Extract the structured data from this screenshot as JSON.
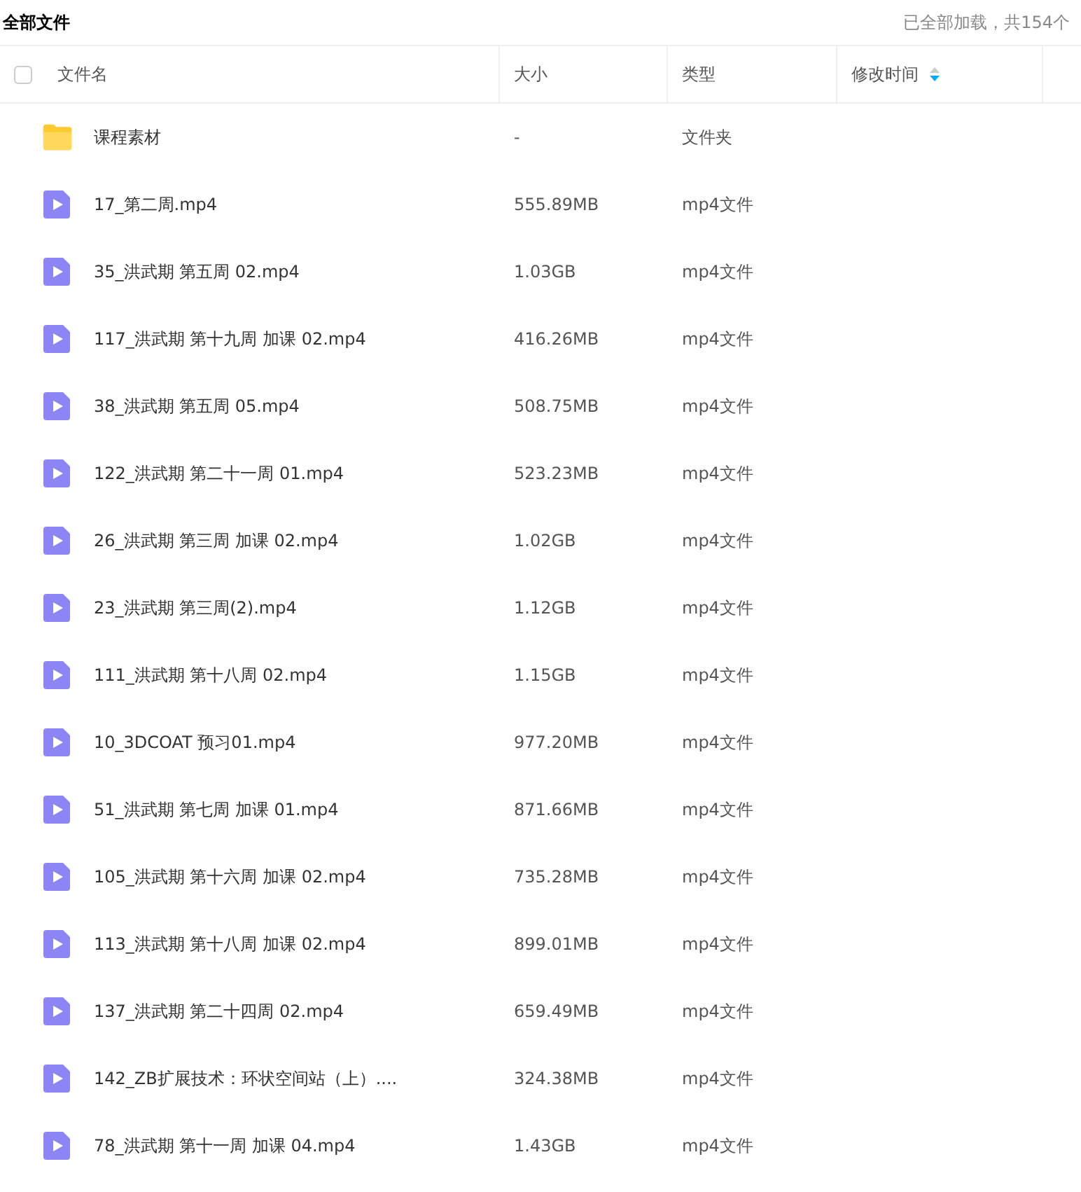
{
  "title": "全部文件",
  "load_status": "已全部加载，共154个",
  "table": {
    "select_all": {
      "checked": false
    },
    "columns": [
      {
        "label": "文件名",
        "sortable": false
      },
      {
        "label": "大小",
        "sortable": false
      },
      {
        "label": "类型",
        "sortable": false
      },
      {
        "label": "修改时间",
        "sortable": true
      }
    ],
    "rows": [
      {
        "kind": "folder",
        "name": "课程素材",
        "size": "-",
        "type": "文件夹"
      },
      {
        "kind": "video",
        "name": "17_第二周.mp4",
        "size": "555.89MB",
        "type": "mp4文件"
      },
      {
        "kind": "video",
        "name": "35_洪武期 第五周 02.mp4",
        "size": "1.03GB",
        "type": "mp4文件"
      },
      {
        "kind": "video",
        "name": "117_洪武期 第十九周 加课 02.mp4",
        "size": "416.26MB",
        "type": "mp4文件"
      },
      {
        "kind": "video",
        "name": "38_洪武期 第五周 05.mp4",
        "size": "508.75MB",
        "type": "mp4文件"
      },
      {
        "kind": "video",
        "name": "122_洪武期 第二十一周 01.mp4",
        "size": "523.23MB",
        "type": "mp4文件"
      },
      {
        "kind": "video",
        "name": "26_洪武期 第三周 加课 02.mp4",
        "size": "1.02GB",
        "type": "mp4文件"
      },
      {
        "kind": "video",
        "name": "23_洪武期 第三周(2).mp4",
        "size": "1.12GB",
        "type": "mp4文件"
      },
      {
        "kind": "video",
        "name": "111_洪武期 第十八周 02.mp4",
        "size": "1.15GB",
        "type": "mp4文件"
      },
      {
        "kind": "video",
        "name": "10_3DCOAT 预习01.mp4",
        "size": "977.20MB",
        "type": "mp4文件"
      },
      {
        "kind": "video",
        "name": "51_洪武期 第七周 加课 01.mp4",
        "size": "871.66MB",
        "type": "mp4文件"
      },
      {
        "kind": "video",
        "name": "105_洪武期 第十六周 加课 02.mp4",
        "size": "735.28MB",
        "type": "mp4文件"
      },
      {
        "kind": "video",
        "name": "113_洪武期 第十八周 加课 02.mp4",
        "size": "899.01MB",
        "type": "mp4文件"
      },
      {
        "kind": "video",
        "name": "137_洪武期 第二十四周 02.mp4",
        "size": "659.49MB",
        "type": "mp4文件"
      },
      {
        "kind": "video",
        "name": "142_ZB扩展技术：环状空间站（上）....",
        "size": "324.38MB",
        "type": "mp4文件"
      },
      {
        "kind": "video",
        "name": "78_洪武期 第十一周 加课 04.mp4",
        "size": "1.43GB",
        "type": "mp4文件"
      }
    ]
  }
}
